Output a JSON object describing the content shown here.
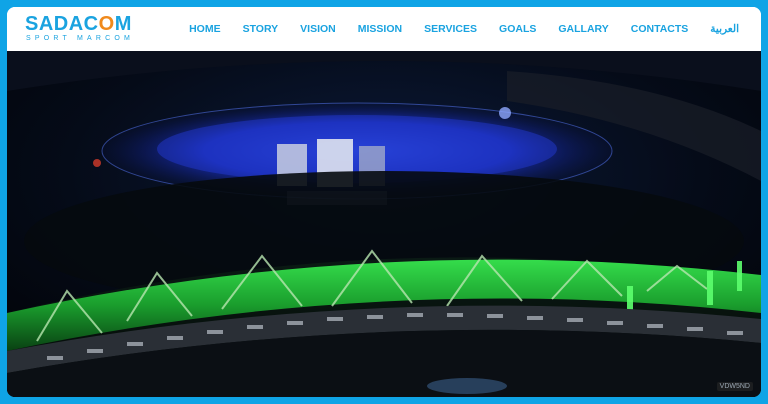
{
  "brand": {
    "name_part1": "SADAC",
    "name_part2": "O",
    "name_part3": "M",
    "tagline": "SPORT MARCOM",
    "primary_color": "#1aa3e0",
    "accent_color": "#f08a1c"
  },
  "nav": {
    "items": [
      {
        "label": "HOME"
      },
      {
        "label": "STORY"
      },
      {
        "label": "VISION"
      },
      {
        "label": "MISSION"
      },
      {
        "label": "SERVICES"
      },
      {
        "label": "GOALS"
      },
      {
        "label": "GALLARY"
      },
      {
        "label": "CONTACTS"
      },
      {
        "label": "العربية"
      }
    ]
  },
  "hero": {
    "description_icon": "stadium-video-image",
    "watermark": "VDW5ND"
  },
  "colors": {
    "frame_border": "#0fa4e6",
    "stadium_green": "#22d13a",
    "ufo_blue": "#1f3bd8"
  }
}
